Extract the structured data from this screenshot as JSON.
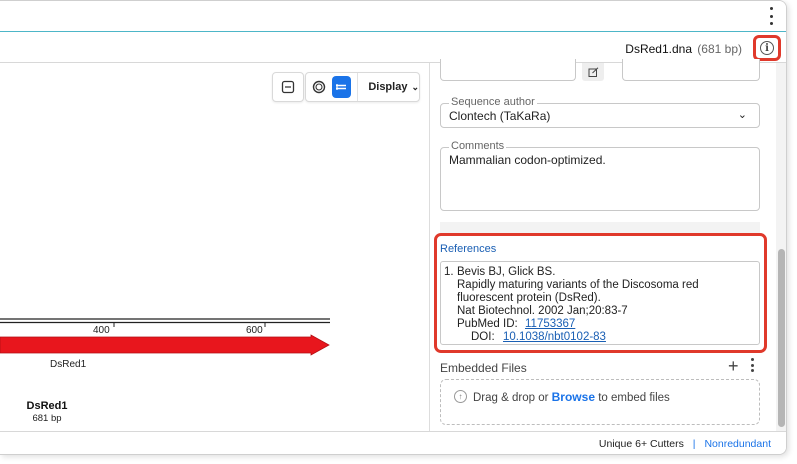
{
  "sequence": {
    "name": "DsRed1.dna",
    "length": "(681 bp)"
  },
  "toolbar": {
    "display_label": "Display",
    "accent": "#1a73e8"
  },
  "map": {
    "feature_label": "DsRed1",
    "title": "DsRed1",
    "length": "681 bp",
    "ticks": [
      "400",
      "600"
    ],
    "feature_color": "#e8161d"
  },
  "panel": {
    "sequence_author": {
      "label": "Sequence author",
      "value": "Clontech (TaKaRa)"
    },
    "comments": {
      "label": "Comments",
      "value": "Mammalian codon-optimized."
    },
    "references": {
      "title": "References",
      "number": "1.",
      "authors": "Bevis BJ, Glick BS.",
      "title_line1": "Rapidly maturing variants of the Discosoma red",
      "title_line2": "fluorescent protein (DsRed).",
      "journal": "Nat Biotechnol. 2002 Jan;20:83-7",
      "pubmed_label": "PubMed ID:",
      "pubmed_id": "11753367",
      "doi_label": "DOI:",
      "doi": "10.1038/nbt0102-83"
    },
    "embedded_files": {
      "title": "Embedded Files",
      "drop_text": "Drag & drop or",
      "browse": "Browse",
      "drop_suffix": "to embed files"
    }
  },
  "footer": {
    "cutters": "Unique 6+ Cutters",
    "separator": "|",
    "mode": "Nonredundant"
  },
  "highlight_color": "#e0392b"
}
